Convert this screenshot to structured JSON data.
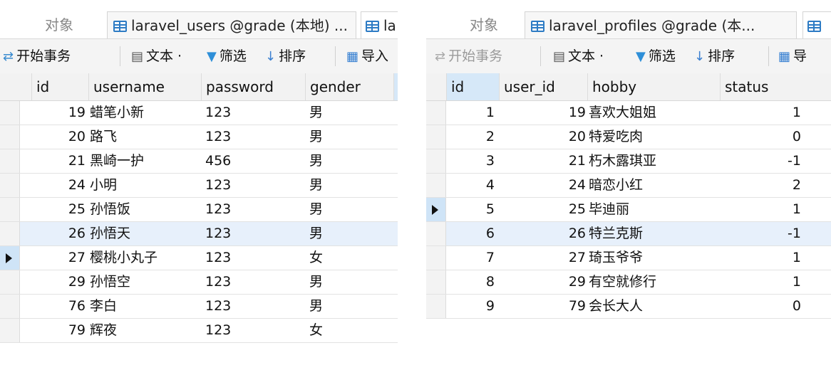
{
  "left": {
    "tabs": {
      "objects": "对象",
      "active": "laravel_users @grade (本地) ...",
      "partial": "la"
    },
    "toolbar": {
      "begin": "开始事务",
      "text": "文本 ·",
      "filter": "筛选",
      "sort": "排序",
      "import": "导入"
    },
    "columns": [
      "id",
      "username",
      "password",
      "gender"
    ],
    "rows": [
      {
        "id": "19",
        "username": "蜡笔小新",
        "password": "123",
        "gender": "男"
      },
      {
        "id": "20",
        "username": "路飞",
        "password": "123",
        "gender": "男"
      },
      {
        "id": "21",
        "username": "黑崎一护",
        "password": "456",
        "gender": "男"
      },
      {
        "id": "24",
        "username": "小明",
        "password": "123",
        "gender": "男"
      },
      {
        "id": "25",
        "username": "孙悟饭",
        "password": "123",
        "gender": "男"
      },
      {
        "id": "26",
        "username": "孙悟天",
        "password": "123",
        "gender": "男"
      },
      {
        "id": "27",
        "username": "樱桃小丸子",
        "password": "123",
        "gender": "女"
      },
      {
        "id": "29",
        "username": "孙悟空",
        "password": "123",
        "gender": "男"
      },
      {
        "id": "76",
        "username": "李白",
        "password": "123",
        "gender": "男"
      },
      {
        "id": "79",
        "username": "辉夜",
        "password": "123",
        "gender": "女"
      }
    ]
  },
  "right": {
    "tabs": {
      "objects": "对象",
      "active": "laravel_profiles @grade (本..."
    },
    "toolbar": {
      "begin": "开始事务",
      "text": "文本 ·",
      "filter": "筛选",
      "sort": "排序",
      "import": "导"
    },
    "columns": [
      "id",
      "user_id",
      "hobby",
      "status"
    ],
    "rows": [
      {
        "id": "1",
        "user_id": "19",
        "hobby": "喜欢大姐姐",
        "status": "1"
      },
      {
        "id": "2",
        "user_id": "20",
        "hobby": "特爱吃肉",
        "status": "0"
      },
      {
        "id": "3",
        "user_id": "21",
        "hobby": "朽木露琪亚",
        "status": "-1"
      },
      {
        "id": "4",
        "user_id": "24",
        "hobby": "暗恋小红",
        "status": "2"
      },
      {
        "id": "5",
        "user_id": "25",
        "hobby": "毕迪丽",
        "status": "1"
      },
      {
        "id": "6",
        "user_id": "26",
        "hobby": "特兰克斯",
        "status": "-1"
      },
      {
        "id": "7",
        "user_id": "27",
        "hobby": "琦玉爷爷",
        "status": "1"
      },
      {
        "id": "8",
        "user_id": "29",
        "hobby": "有空就修行",
        "status": "1"
      },
      {
        "id": "9",
        "user_id": "79",
        "hobby": "会长大人",
        "status": "0"
      }
    ]
  },
  "colors": {
    "accent": "#2d7bc4",
    "selected_row": "#e7f0fb",
    "header_bg": "#f2f2f2"
  }
}
